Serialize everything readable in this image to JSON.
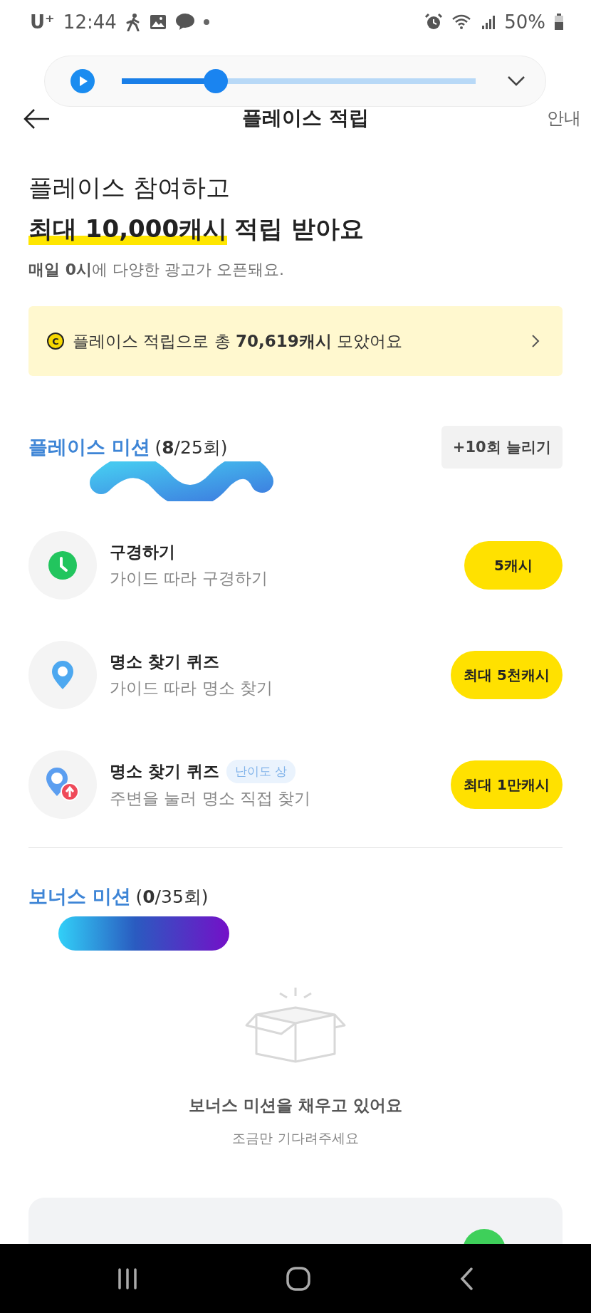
{
  "status_bar": {
    "carrier": "U⁺",
    "time": "12:44",
    "battery": "50%"
  },
  "player": {
    "level": 0.265
  },
  "header": {
    "title": "플레이스 적립",
    "action": "안내"
  },
  "hero": {
    "line1": "플레이스 참여하고",
    "highlight": "최대 10,000캐시",
    "rest": "적립 받아요",
    "note": "**매일 0시**에 다양한 광고가 오픈돼요."
  },
  "banner": {
    "coin": "C",
    "text": "플레이스 적립으로 총 **70,619캐시** 모았어요"
  },
  "missions": {
    "title": "플레이스 미션",
    "count": "(**8**/25회)",
    "button": "+10회 늘리기",
    "items": [
      {
        "kind": "clock",
        "title": "구경하기",
        "subtitle": "가이드 따라 구경하기",
        "reward": "5캐시"
      },
      {
        "kind": "pin",
        "title": "명소 찾기 퀴즈",
        "subtitle": "가이드 따라 명소 찾기",
        "reward": "최대 5천캐시"
      },
      {
        "kind": "pin-up",
        "title": "명소 찾기 퀴즈",
        "badge": "난이도 상",
        "subtitle": "주변을 눌러 명소 직접 찾기",
        "reward": "최대 1만캐시"
      }
    ]
  },
  "bonus": {
    "title": "보너스 미션",
    "count": "(**0**/35회)",
    "empty_title": "보너스 미션을 채우고 있어요",
    "empty_text": "조금만 기다려주세요"
  }
}
